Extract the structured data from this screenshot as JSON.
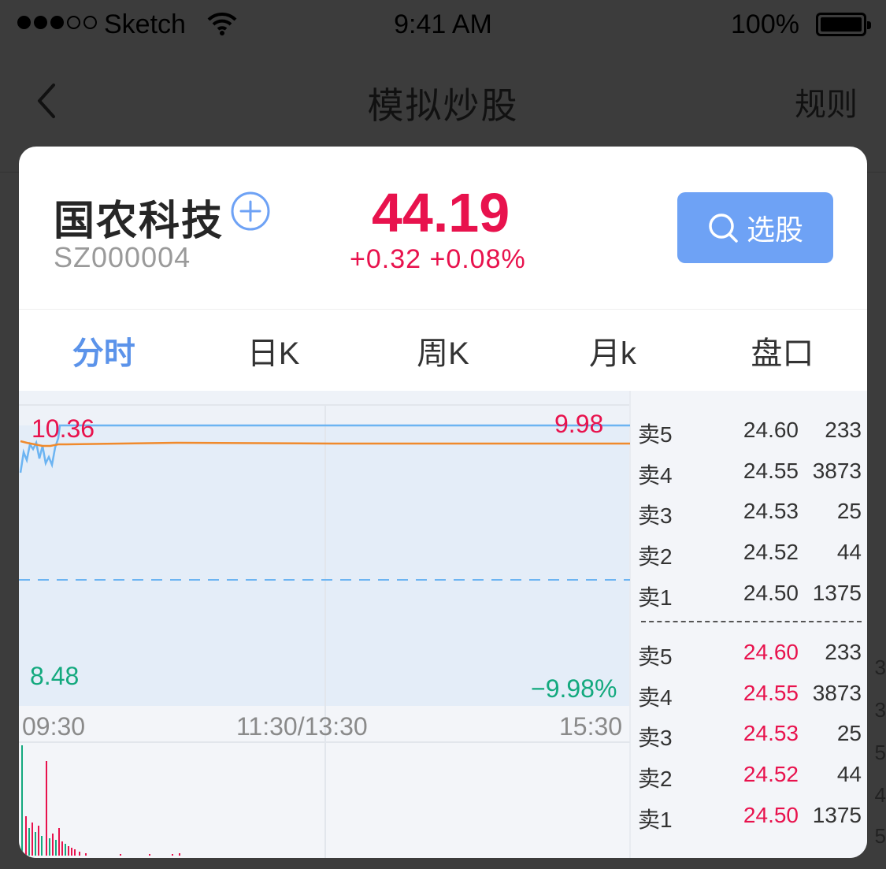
{
  "status_bar": {
    "carrier": "Sketch",
    "time": "9:41 AM",
    "battery": "100%"
  },
  "nav": {
    "title": "模拟炒股",
    "rules": "规则"
  },
  "stock": {
    "name": "国农科技",
    "code": "SZ000004",
    "price": "44.19",
    "change": "+0.32  +0.08%",
    "select_label": "选股"
  },
  "tabs": [
    {
      "label": "分时",
      "active": true
    },
    {
      "label": "日K",
      "active": false
    },
    {
      "label": "周K",
      "active": false
    },
    {
      "label": "月k",
      "active": false
    },
    {
      "label": "盘口",
      "active": false
    }
  ],
  "chart_labels": {
    "high": "10.36",
    "high_pct": "9.98",
    "low": "8.48",
    "low_pct": "−9.98%",
    "time_start": "09:30",
    "time_mid": "11:30/13:30",
    "time_end": "15:30"
  },
  "order_book": {
    "asks": [
      {
        "level": "卖5",
        "price": "24.60",
        "volume": "233"
      },
      {
        "level": "卖4",
        "price": "24.55",
        "volume": "3873"
      },
      {
        "level": "卖3",
        "price": "24.53",
        "volume": "25"
      },
      {
        "level": "卖2",
        "price": "24.52",
        "volume": "44"
      },
      {
        "level": "卖1",
        "price": "24.50",
        "volume": "1375"
      }
    ],
    "bids": [
      {
        "level": "卖5",
        "price": "24.60",
        "volume": "233"
      },
      {
        "level": "卖4",
        "price": "24.55",
        "volume": "3873"
      },
      {
        "level": "卖3",
        "price": "24.53",
        "volume": "25"
      },
      {
        "level": "卖2",
        "price": "24.52",
        "volume": "44"
      },
      {
        "level": "卖1",
        "price": "24.50",
        "volume": "1375"
      }
    ]
  },
  "colors": {
    "up": "#e8124d",
    "down": "#13a97e",
    "accent": "#6ea2f5",
    "price_line": "#6cb4f2",
    "avg_line": "#f08a2c"
  },
  "icons": {
    "back": "chevron-left-icon",
    "add": "plus-circle-icon",
    "search": "search-icon",
    "wifi": "wifi-icon",
    "battery": "battery-icon"
  },
  "background_page_edge": [
    "3",
    "3",
    "5",
    "4",
    "5"
  ]
}
